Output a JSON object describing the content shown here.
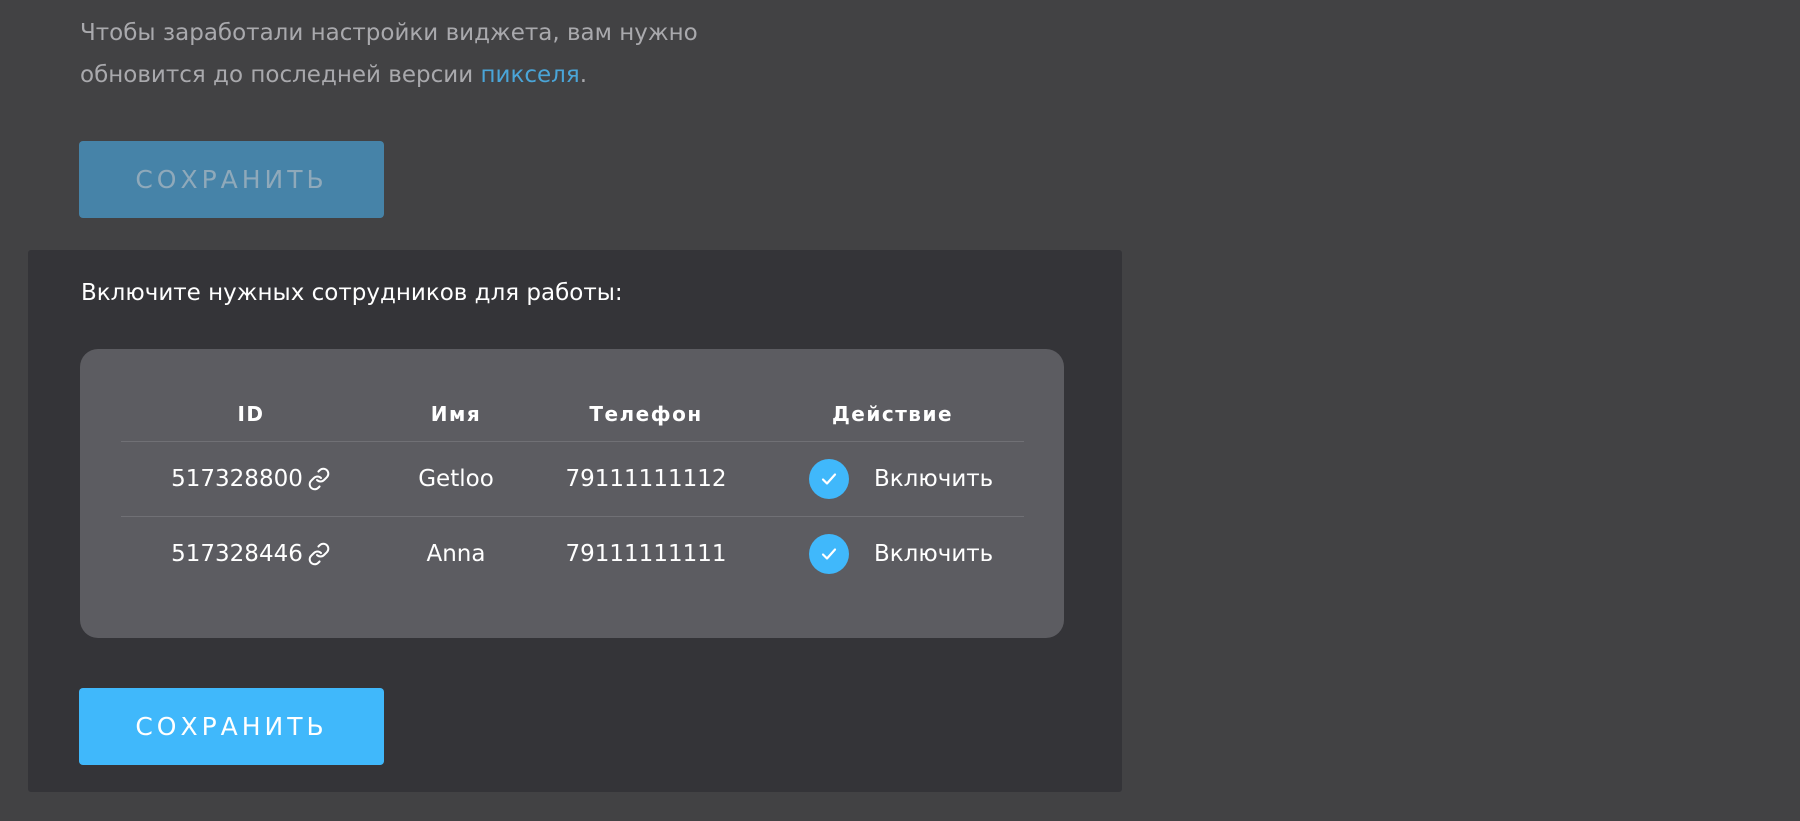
{
  "notice": {
    "text_before": "Чтобы заработали настройки виджета, вам нужно обновится до последней версии ",
    "link_text": "пикселя",
    "text_after": "."
  },
  "top_save_button": {
    "label": "СОХРАНИТЬ"
  },
  "employees": {
    "title": "Включите нужных сотрудников для работы:",
    "columns": [
      "ID",
      "Имя",
      "Телефон",
      "Действие"
    ],
    "rows": [
      {
        "id": "517328800",
        "name": "Getloo",
        "phone": "79111111112",
        "action": "Включить",
        "enabled": true
      },
      {
        "id": "517328446",
        "name": "Anna",
        "phone": "79111111111",
        "action": "Включить",
        "enabled": true
      }
    ]
  },
  "bottom_save_button": {
    "label": "СОХРАНИТЬ"
  },
  "colors": {
    "background": "#424244",
    "panel": "#343438",
    "table_card": "#5c5c61",
    "accent": "#40b8fb",
    "disabled_button": "#4683a8",
    "link": "#4aa5d8"
  }
}
